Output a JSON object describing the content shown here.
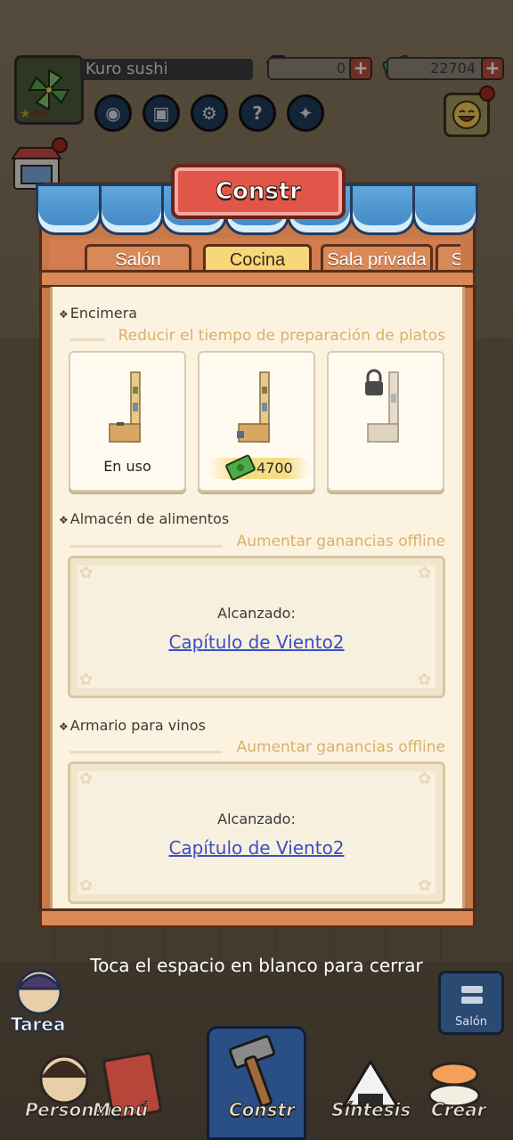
{
  "hud": {
    "player_name": "Kuro sushi",
    "gems": "0",
    "cash": "22704",
    "rating_stars": 1,
    "rating_max": 3,
    "buttons": [
      "eye-icon",
      "camera-icon",
      "gear-icon",
      "help-icon",
      "bookmark-icon"
    ]
  },
  "side": {
    "shop_label": "SHOP"
  },
  "modal": {
    "title": "Constr",
    "tabs": [
      {
        "label": "Salón",
        "active": false
      },
      {
        "label": "Cocina",
        "active": true
      },
      {
        "label": "Sala privada",
        "active": false
      },
      {
        "label": "Se",
        "active": false
      }
    ],
    "sections": {
      "counter": {
        "title": "Encimera",
        "subtitle": "Reducir el tiempo de preparación de platos",
        "items": [
          {
            "status": "En uso"
          },
          {
            "price": "4700"
          },
          {
            "locked": true
          }
        ]
      },
      "storage": {
        "title": "Almacén de alimentos",
        "subtitle": "Aumentar ganancias offline",
        "reached_label": "Alcanzado:",
        "reached_link": "Capítulo de Viento2"
      },
      "wine": {
        "title": "Armario para vinos",
        "subtitle": "Aumentar ganancias offline",
        "reached_label": "Alcanzado:",
        "reached_link": "Capítulo de Viento2"
      }
    },
    "close_hint": "Toca el espacio en blanco para cerrar"
  },
  "bottom_nav": {
    "task_label": "Tarea",
    "salon_label": "Salón",
    "items": [
      {
        "label": "Personal"
      },
      {
        "label": "Menú"
      },
      {
        "label": "Constr"
      },
      {
        "label": "Síntesis"
      },
      {
        "label": "Crear"
      }
    ]
  },
  "colors": {
    "title_banner": "#e0574a",
    "awning_blue": "#4a92cf",
    "active_tab": "#f7d77a",
    "link": "#3a4fc4",
    "subtitle": "#d9b06e"
  }
}
